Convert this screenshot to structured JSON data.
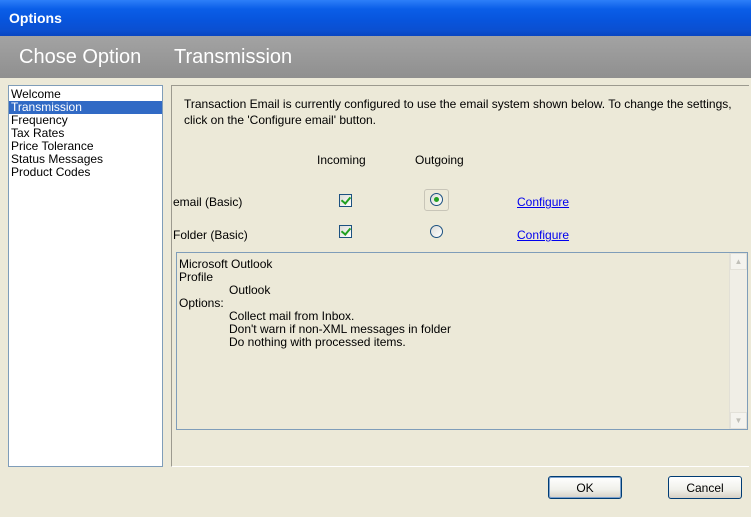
{
  "window": {
    "title": "Options"
  },
  "header": {
    "left_title": "Chose Option",
    "right_title": "Transmission"
  },
  "sidebar": {
    "items": [
      {
        "label": "Welcome",
        "selected": false
      },
      {
        "label": "Transmission",
        "selected": true
      },
      {
        "label": "Frequency",
        "selected": false
      },
      {
        "label": "Tax Rates",
        "selected": false
      },
      {
        "label": "Price Tolerance",
        "selected": false
      },
      {
        "label": "Status Messages",
        "selected": false
      },
      {
        "label": "Product Codes",
        "selected": false
      }
    ]
  },
  "main": {
    "description": "Transaction Email is currently configured to use the email system shown below. To change the settings, click on the 'Configure email' button.",
    "columns": {
      "incoming": "Incoming",
      "outgoing": "Outgoing"
    },
    "rows": [
      {
        "label": "email (Basic)",
        "incoming_checked": true,
        "outgoing_selected": true,
        "configure_label": "Configure"
      },
      {
        "label": "Folder (Basic)",
        "incoming_checked": true,
        "outgoing_selected": false,
        "configure_label": "Configure"
      }
    ],
    "info": {
      "line1": "Microsoft Outlook",
      "line2": "Profile",
      "line3": "Outlook",
      "line4": "Options:",
      "line5": "Collect mail from Inbox.",
      "line6": "Don't warn if non-XML messages in folder",
      "line7": "Do nothing with processed items."
    }
  },
  "footer": {
    "ok_label": "OK",
    "cancel_label": "Cancel"
  },
  "colors": {
    "title_blue": "#0855dd",
    "header_gray": "#999999",
    "selection_blue": "#316ac5",
    "check_green": "#21a121",
    "link_blue": "#0000ee"
  },
  "icons": {
    "scroll_up": "scroll-up-icon",
    "scroll_down": "scroll-down-icon"
  }
}
